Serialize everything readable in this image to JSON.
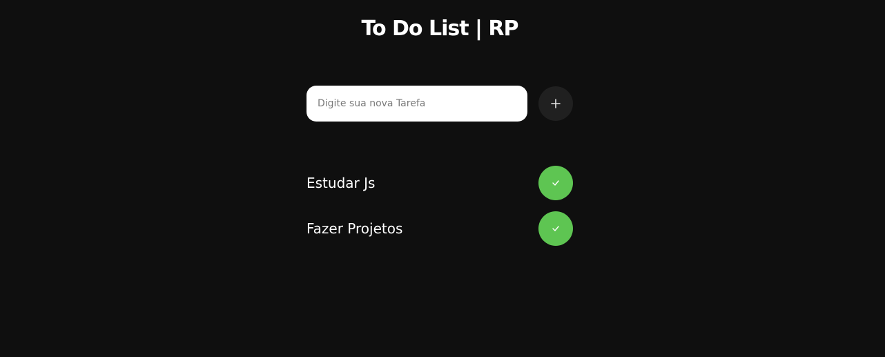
{
  "header": {
    "title": "To Do List | RP"
  },
  "new_task": {
    "placeholder": "Digite sua nova Tarefa",
    "value": "",
    "add_icon": "plus-icon"
  },
  "tasks": [
    {
      "label": "Estudar Js",
      "action_icon": "check-icon"
    },
    {
      "label": "Fazer Projetos",
      "action_icon": "check-icon"
    }
  ],
  "colors": {
    "background": "#0f0f0f",
    "input_background": "#ffffff",
    "add_button": "#202020",
    "check_button": "#5ec552",
    "text": "#ffffff"
  }
}
